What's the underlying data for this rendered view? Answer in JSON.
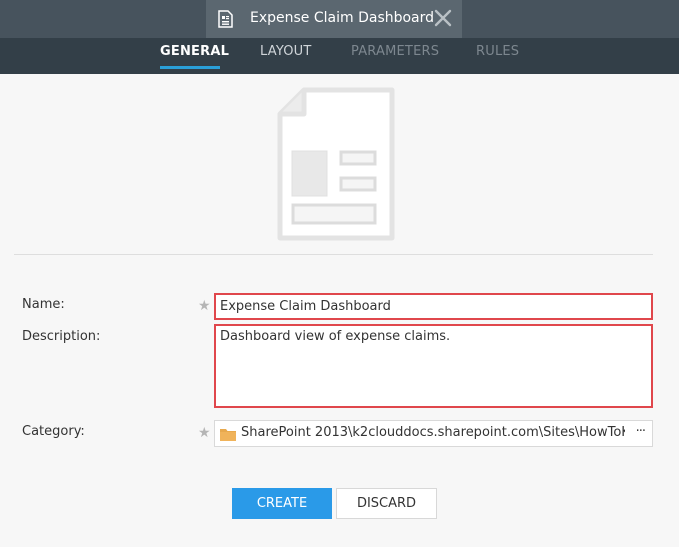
{
  "window": {
    "doc_title": "Expense Claim Dashboard",
    "doc_icon": "form-document-icon",
    "close_icon": "close-icon"
  },
  "tabs": [
    {
      "label": "GENERAL",
      "state": "active"
    },
    {
      "label": "LAYOUT",
      "state": "enabled"
    },
    {
      "label": "PARAMETERS",
      "state": "disabled"
    },
    {
      "label": "RULES",
      "state": "disabled"
    }
  ],
  "hero": {
    "icon": "form-template-icon"
  },
  "form": {
    "name_label": "Name:",
    "name_value": "Expense Claim Dashboard",
    "description_label": "Description:",
    "description_value": "Dashboard view of expense claims.",
    "category_label": "Category:",
    "category_value": "SharePoint 2013\\k2clouddocs.sharepoint.com\\Sites\\HowToK",
    "category_more": "···",
    "required_marker": "★"
  },
  "actions": {
    "create_label": "CREATE",
    "discard_label": "DISCARD"
  },
  "colors": {
    "header_dark": "#333f48",
    "accent": "#2a9ae8",
    "highlight_border": "#e0474c"
  }
}
